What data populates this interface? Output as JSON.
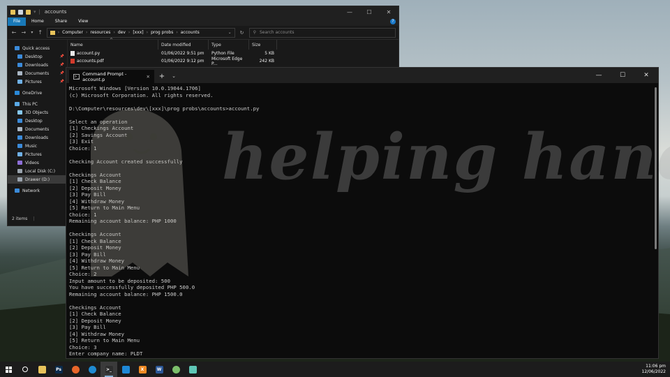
{
  "explorer": {
    "title": "accounts",
    "ribbon_tabs": [
      "File",
      "Home",
      "Share",
      "View"
    ],
    "path": [
      "Computer",
      "resources",
      "dev",
      "[xxx]",
      "prog probs",
      "accounts"
    ],
    "search_placeholder": "Search accounts",
    "sidebar": [
      {
        "label": "Quick access",
        "level": 0,
        "icon": "star-icon"
      },
      {
        "label": "Desktop",
        "level": 1,
        "icon": "desktop-icon",
        "pinned": true
      },
      {
        "label": "Downloads",
        "level": 1,
        "icon": "downloads-icon",
        "pinned": true
      },
      {
        "label": "Documents",
        "level": 1,
        "icon": "documents-icon",
        "pinned": true
      },
      {
        "label": "Pictures",
        "level": 1,
        "icon": "pictures-icon",
        "pinned": true
      },
      {
        "label": "OneDrive",
        "level": 0,
        "icon": "cloud-icon"
      },
      {
        "label": "This PC",
        "level": 0,
        "icon": "pc-icon"
      },
      {
        "label": "3D Objects",
        "level": 1,
        "icon": "cube-icon"
      },
      {
        "label": "Desktop",
        "level": 1,
        "icon": "desktop-icon"
      },
      {
        "label": "Documents",
        "level": 1,
        "icon": "documents-icon"
      },
      {
        "label": "Downloads",
        "level": 1,
        "icon": "downloads-icon"
      },
      {
        "label": "Music",
        "level": 1,
        "icon": "music-icon"
      },
      {
        "label": "Pictures",
        "level": 1,
        "icon": "pictures-icon"
      },
      {
        "label": "Videos",
        "level": 1,
        "icon": "videos-icon"
      },
      {
        "label": "Local Disk (C:)",
        "level": 1,
        "icon": "drive-icon"
      },
      {
        "label": "Drawer (D:)",
        "level": 1,
        "icon": "drive-icon",
        "selected": true
      },
      {
        "label": "Network",
        "level": 0,
        "icon": "network-icon"
      }
    ],
    "columns": [
      "Name",
      "Date modified",
      "Type",
      "Size"
    ],
    "files": [
      {
        "name": "account.py",
        "date": "01/06/2022 9:51 pm",
        "type": "Python File",
        "size": "5 KB",
        "icon": "python-file-icon"
      },
      {
        "name": "accounts.pdf",
        "date": "01/06/2022 9:12 pm",
        "type": "Microsoft Edge P...",
        "size": "242 KB",
        "icon": "pdf-file-icon"
      }
    ],
    "status": "2 items"
  },
  "terminal": {
    "tab_title": "Command Prompt - account.p",
    "lines": [
      "Microsoft Windows [Version 10.0.19044.1706]",
      "(c) Microsoft Corporation. All rights reserved.",
      "",
      "D:\\Computer\\resources\\dev\\[xxx]\\prog probs\\accounts>account.py",
      "",
      "Select an operation",
      "[1] Checkings Account",
      "[2] Savings Account",
      "[3] Exit",
      "Choice: 1",
      "",
      "Checking Account created successfully",
      "",
      "Checkings Account",
      "[1] Check Balance",
      "[2] Deposit Money",
      "[3] Pay Bill",
      "[4] Withdraw Money",
      "[5] Return to Main Menu",
      "Choice: 1",
      "Remaining account balance: PHP 1000",
      "",
      "Checkings Account",
      "[1] Check Balance",
      "[2] Deposit Money",
      "[3] Pay Bill",
      "[4] Withdraw Money",
      "[5] Return to Main Menu",
      "Choice: 2",
      "Input amount to be deposited: 500",
      "You have successfully deposited PHP 500.0",
      "Remaining account balance: PHP 1500.0",
      "",
      "Checkings Account",
      "[1] Check Balance",
      "[2] Deposit Money",
      "[3] Pay Bill",
      "[4] Withdraw Money",
      "[5] Return to Main Menu",
      "Choice: 3",
      "Enter company name: PLDT"
    ]
  },
  "watermark": "helping hand",
  "taskbar": {
    "apps": [
      {
        "name": "search-icon",
        "label": "",
        "color": "#1c1c1c"
      },
      {
        "name": "file-explorer-icon",
        "label": "",
        "color": "#e8c35b"
      },
      {
        "name": "photoshop-icon",
        "label": "Ps",
        "color": "#0a2b4d"
      },
      {
        "name": "firefox-icon",
        "label": "",
        "color": "#e8662a"
      },
      {
        "name": "edge-icon",
        "label": "",
        "color": "#1f8ad1"
      },
      {
        "name": "terminal-icon",
        "label": ">_",
        "color": "#2d2d2d",
        "active": true
      },
      {
        "name": "vscode-icon",
        "label": "",
        "color": "#1e88d6"
      },
      {
        "name": "xampp-icon",
        "label": "X",
        "color": "#f08a24"
      },
      {
        "name": "word-icon",
        "label": "W",
        "color": "#2b5797"
      },
      {
        "name": "app-icon",
        "label": "",
        "color": "#7cbf6b"
      },
      {
        "name": "notes-icon",
        "label": "",
        "color": "#5fc7b6"
      }
    ],
    "time": "11:06 pm",
    "date": "12/06/2022"
  }
}
